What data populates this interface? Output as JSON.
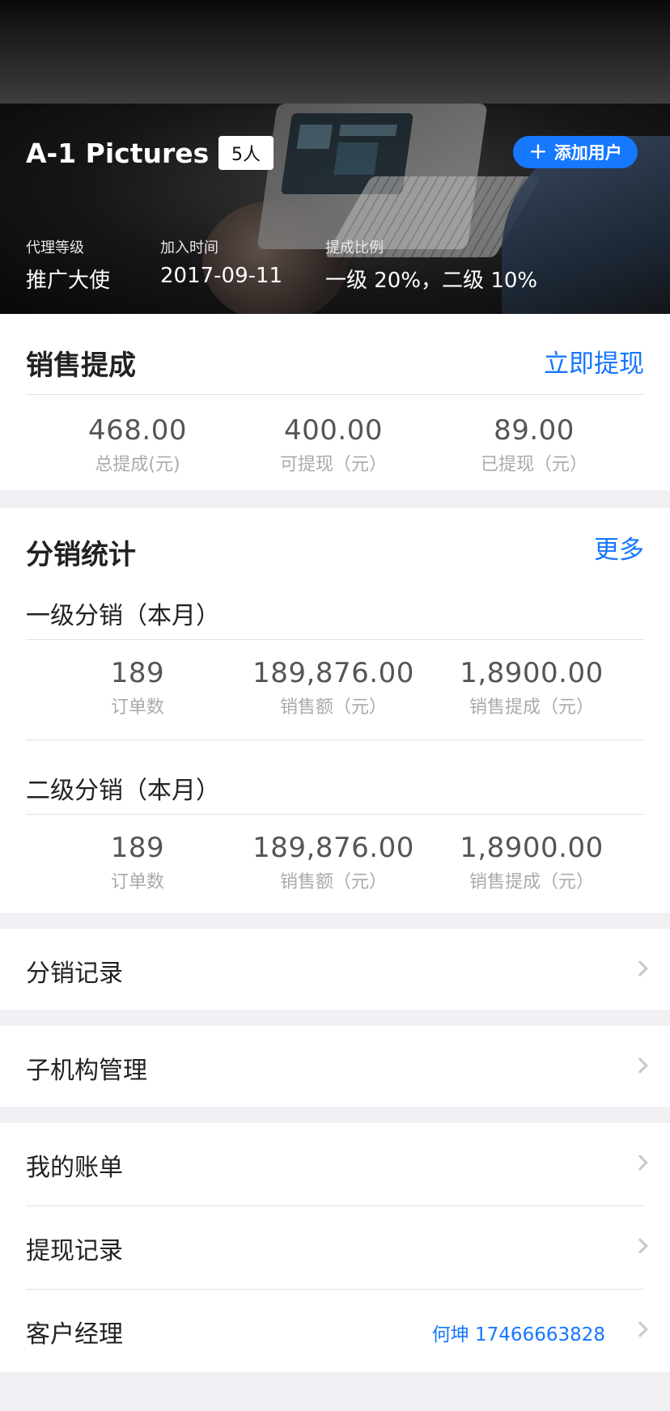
{
  "header": {
    "company": "A-1 Pictures",
    "members": "5人",
    "add_user": "添加用户",
    "fields": [
      {
        "label": "代理等级",
        "value": "推广大使"
      },
      {
        "label": "加入时间",
        "value": "2017-09-11"
      },
      {
        "label": "提成比例",
        "value": "一级 20%，二级 10%"
      }
    ]
  },
  "sales_commission": {
    "title": "销售提成",
    "action": "立即提现",
    "stats": [
      {
        "value": "468.00",
        "caption": "总提成(元)"
      },
      {
        "value": "400.00",
        "caption": "可提现（元）"
      },
      {
        "value": "89.00",
        "caption": "已提现（元）"
      }
    ]
  },
  "distribution_stats": {
    "title": "分销统计",
    "action": "更多",
    "level1": {
      "title": "一级分销（本月）",
      "stats": [
        {
          "value": "189",
          "caption": "订单数"
        },
        {
          "value": "189,876.00",
          "caption": "销售额（元）"
        },
        {
          "value": "1,8900.00",
          "caption": "销售提成（元）"
        }
      ]
    },
    "level2": {
      "title": "二级分销（本月）",
      "stats": [
        {
          "value": "189",
          "caption": "订单数"
        },
        {
          "value": "189,876.00",
          "caption": "销售额（元）"
        },
        {
          "value": "1,8900.00",
          "caption": "销售提成（元）"
        }
      ]
    }
  },
  "menu": {
    "distribution_records": "分销记录",
    "sub_org": "子机构管理",
    "my_bills": "我的账单",
    "withdraw_records": "提现记录",
    "account_manager": "客户经理",
    "account_manager_value": "何坤 17466663828"
  },
  "colors": {
    "accent": "#1677ff",
    "background": "#f0f0f5"
  }
}
